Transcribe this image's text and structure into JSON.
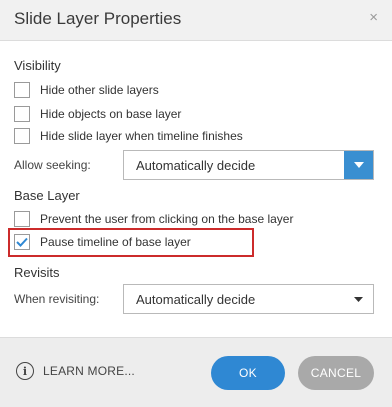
{
  "dialog": {
    "title": "Slide Layer Properties",
    "close_symbol": "×"
  },
  "visibility": {
    "heading": "Visibility",
    "options": [
      {
        "label": "Hide other slide layers",
        "checked": false
      },
      {
        "label": "Hide objects on base layer",
        "checked": false
      },
      {
        "label": "Hide slide layer when timeline finishes",
        "checked": false
      }
    ],
    "seeking_label": "Allow seeking:",
    "seeking_value": "Automatically decide"
  },
  "base_layer": {
    "heading": "Base Layer",
    "options": [
      {
        "label": "Prevent the user from clicking on the base layer",
        "checked": false
      },
      {
        "label": "Pause timeline of base layer",
        "checked": true
      }
    ]
  },
  "revisits": {
    "heading": "Revisits",
    "revisit_label": "When revisiting:",
    "revisit_value": "Automatically decide"
  },
  "footer": {
    "learn_more": "LEARN MORE...",
    "ok_label": "OK",
    "cancel_label": "CANCEL"
  },
  "colors": {
    "accent": "#2f88d3",
    "highlight": "#cc2b2b"
  },
  "icons": {
    "close": "close-icon",
    "info": "info-icon",
    "check": "checkmark-icon",
    "dropdown": "chevron-down-icon"
  }
}
